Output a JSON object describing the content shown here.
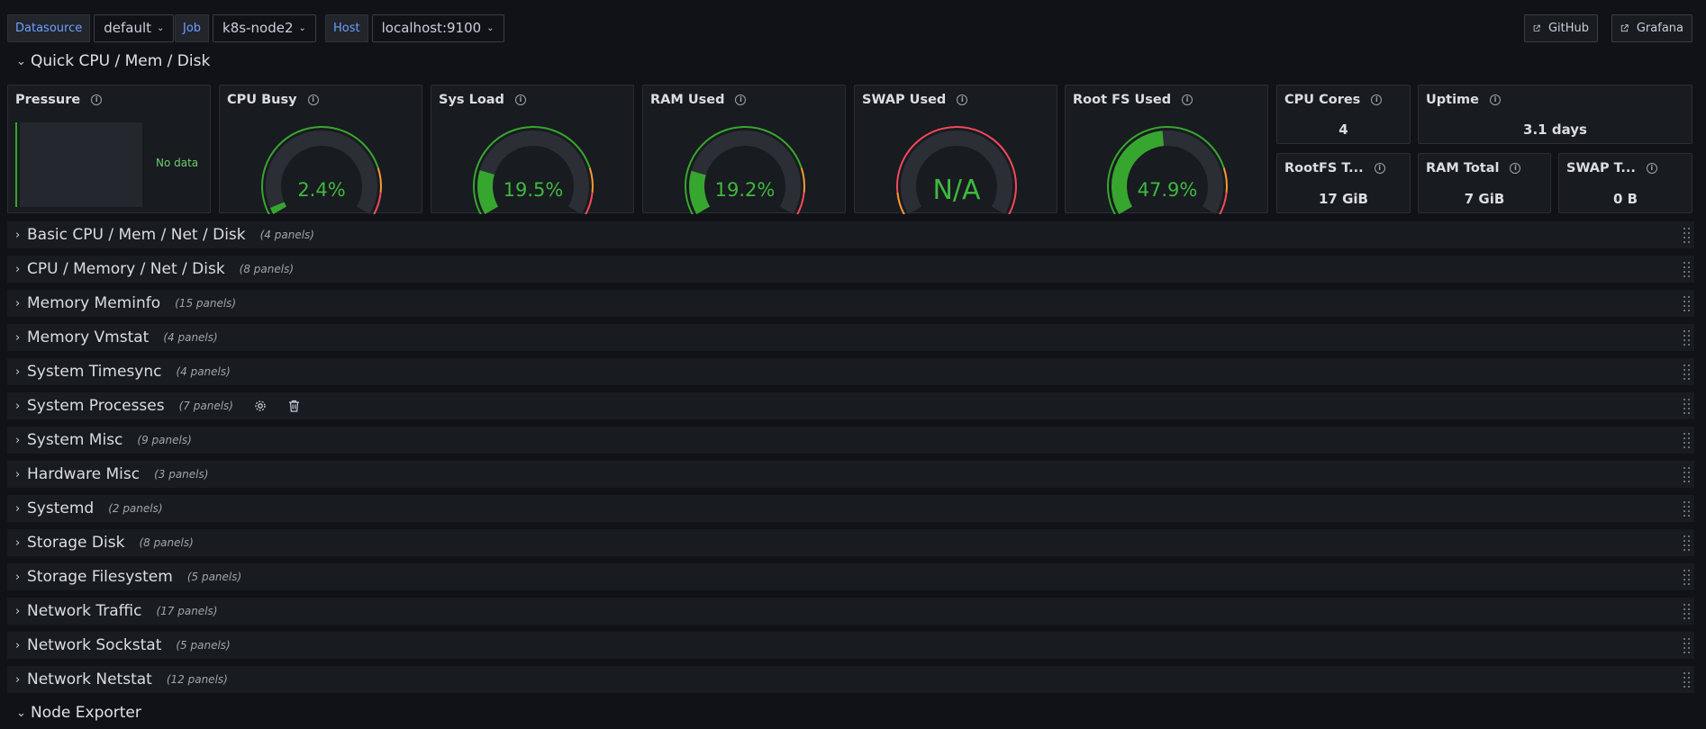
{
  "variables": [
    {
      "label": "Datasource",
      "value": "default"
    },
    {
      "label": "Job",
      "value": "k8s-node2"
    },
    {
      "label": "Host",
      "value": "localhost:9100"
    }
  ],
  "links": [
    {
      "label": "GitHub",
      "icon": "external-link-icon"
    },
    {
      "label": "Grafana",
      "icon": "external-link-icon"
    }
  ],
  "quick_section": {
    "title": "Quick CPU / Mem / Disk",
    "expanded": true
  },
  "panels": {
    "pressure": {
      "title": "Pressure",
      "status": "No data"
    },
    "cpu_busy": {
      "title": "CPU Busy",
      "value": "2.4%",
      "level": 0.024
    },
    "sys_load": {
      "title": "Sys Load",
      "value": "19.5%",
      "level": 0.195
    },
    "ram_used": {
      "title": "RAM Used",
      "value": "19.2%",
      "level": 0.192
    },
    "swap_used": {
      "title": "SWAP Used",
      "value": "N/A",
      "level": 0
    },
    "root_fs_used": {
      "title": "Root FS Used",
      "value": "47.9%",
      "level": 0.479
    },
    "cpu_cores": {
      "title": "CPU Cores",
      "value": "4"
    },
    "uptime": {
      "title": "Uptime",
      "value": "3.1 days"
    },
    "rootfs_total": {
      "title": "RootFS T...",
      "value": "17 GiB"
    },
    "ram_total": {
      "title": "RAM Total",
      "value": "7 GiB"
    },
    "swap_total": {
      "title": "SWAP T...",
      "value": "0 B"
    }
  },
  "colors": {
    "green": "#37a62f",
    "orange": "#ff9830",
    "red": "#f2495c",
    "link_blue": "#6e9fff"
  },
  "rows": [
    {
      "title": "Basic CPU / Mem / Net / Disk",
      "count": "(4 panels)"
    },
    {
      "title": "CPU / Memory / Net / Disk",
      "count": "(8 panels)"
    },
    {
      "title": "Memory Meminfo",
      "count": "(15 panels)"
    },
    {
      "title": "Memory Vmstat",
      "count": "(4 panels)"
    },
    {
      "title": "System Timesync",
      "count": "(4 panels)"
    },
    {
      "title": "System Processes",
      "count": "(7 panels)"
    },
    {
      "title": "System Misc",
      "count": "(9 panels)"
    },
    {
      "title": "Hardware Misc",
      "count": "(3 panels)"
    },
    {
      "title": "Systemd",
      "count": "(2 panels)"
    },
    {
      "title": "Storage Disk",
      "count": "(8 panels)"
    },
    {
      "title": "Storage Filesystem",
      "count": "(5 panels)"
    },
    {
      "title": "Network Traffic",
      "count": "(17 panels)"
    },
    {
      "title": "Network Sockstat",
      "count": "(5 panels)"
    },
    {
      "title": "Network Netstat",
      "count": "(12 panels)"
    }
  ],
  "bottom_section": {
    "title": "Node Exporter",
    "expanded": true
  }
}
